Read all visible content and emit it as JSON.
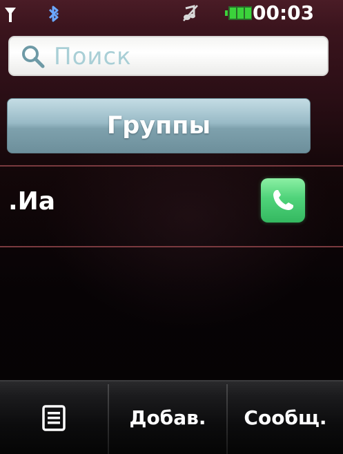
{
  "status_bar": {
    "time": "00:03",
    "icons": [
      "signal-icon",
      "bluetooth-icon",
      "mute-icon",
      "battery-icon"
    ],
    "battery_color": "#3bd23b"
  },
  "search": {
    "placeholder": "Поиск",
    "value": ""
  },
  "groups_button": {
    "label": "Группы"
  },
  "contacts": [
    {
      "name": ".Иа",
      "action_icon": "phone-icon",
      "action_color": "#4fd37a"
    }
  ],
  "toolbar": {
    "menu_icon": "menu-list-icon",
    "add_label": "Добав.",
    "message_label": "Сообщ."
  },
  "colors": {
    "background_top": "#4a1c26",
    "background_bottom": "#050304",
    "divider": "#7a3a3f",
    "groups_button": "#98bac6",
    "search_placeholder": "#a9cfd6"
  }
}
